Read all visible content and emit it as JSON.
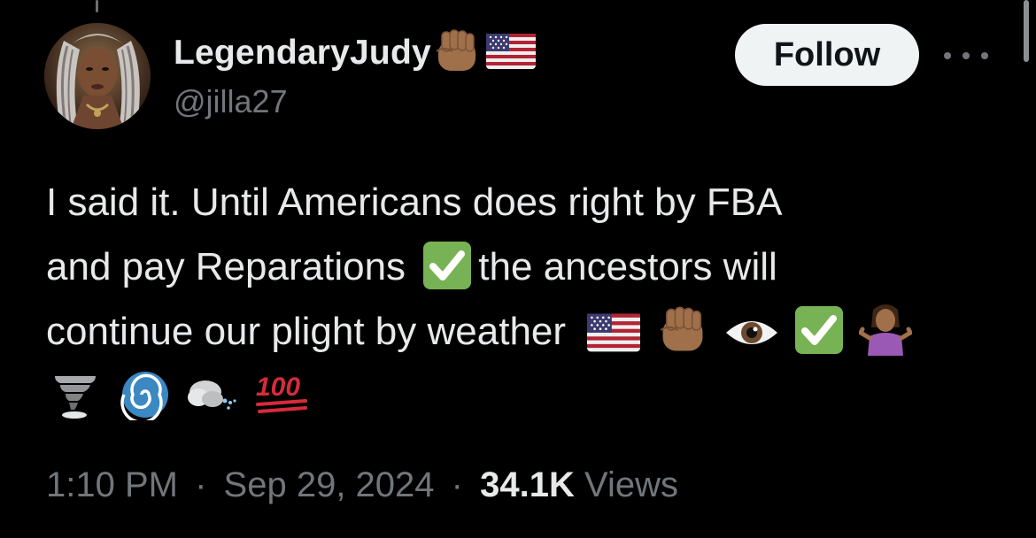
{
  "user": {
    "display_name": "LegendaryJudy",
    "handle": "@jilla27",
    "name_emojis": [
      "raised-fist-medium-dark-icon",
      "us-flag-icon"
    ]
  },
  "follow_button": {
    "label": "Follow"
  },
  "more_button": {
    "icon": "more-horizontal-icon"
  },
  "tweet": {
    "line1": "I said it. Until Americans does right by FBA",
    "line2_a": "and pay Reparations",
    "line2_b": "the ancestors will",
    "line3": "continue our plight by weather",
    "emojis_line2": [
      "check-mark-button-icon"
    ],
    "emojis_line3": [
      "us-flag-icon",
      "raised-fist-medium-dark-icon",
      "eye-icon",
      "check-mark-button-icon",
      "person-shrugging-icon"
    ],
    "emojis_line4": [
      "tornado-icon",
      "cyclone-icon",
      "wind-face-icon",
      "hundred-points-icon"
    ]
  },
  "meta": {
    "time": "1:10 PM",
    "date": "Sep 29, 2024",
    "views_count": "34.1K",
    "views_label": "Views",
    "separator": "·"
  },
  "colors": {
    "background": "#000000",
    "text_primary": "#e7e9ea",
    "text_secondary": "#71767b",
    "follow_bg": "#eff3f4",
    "check_green": "#77b255",
    "flag_red": "#b22334",
    "flag_blue": "#3c3b6e",
    "skin_tone": "#a0704a",
    "hundred_red": "#d62b3b",
    "cyclone_blue": "#3b88c3"
  }
}
